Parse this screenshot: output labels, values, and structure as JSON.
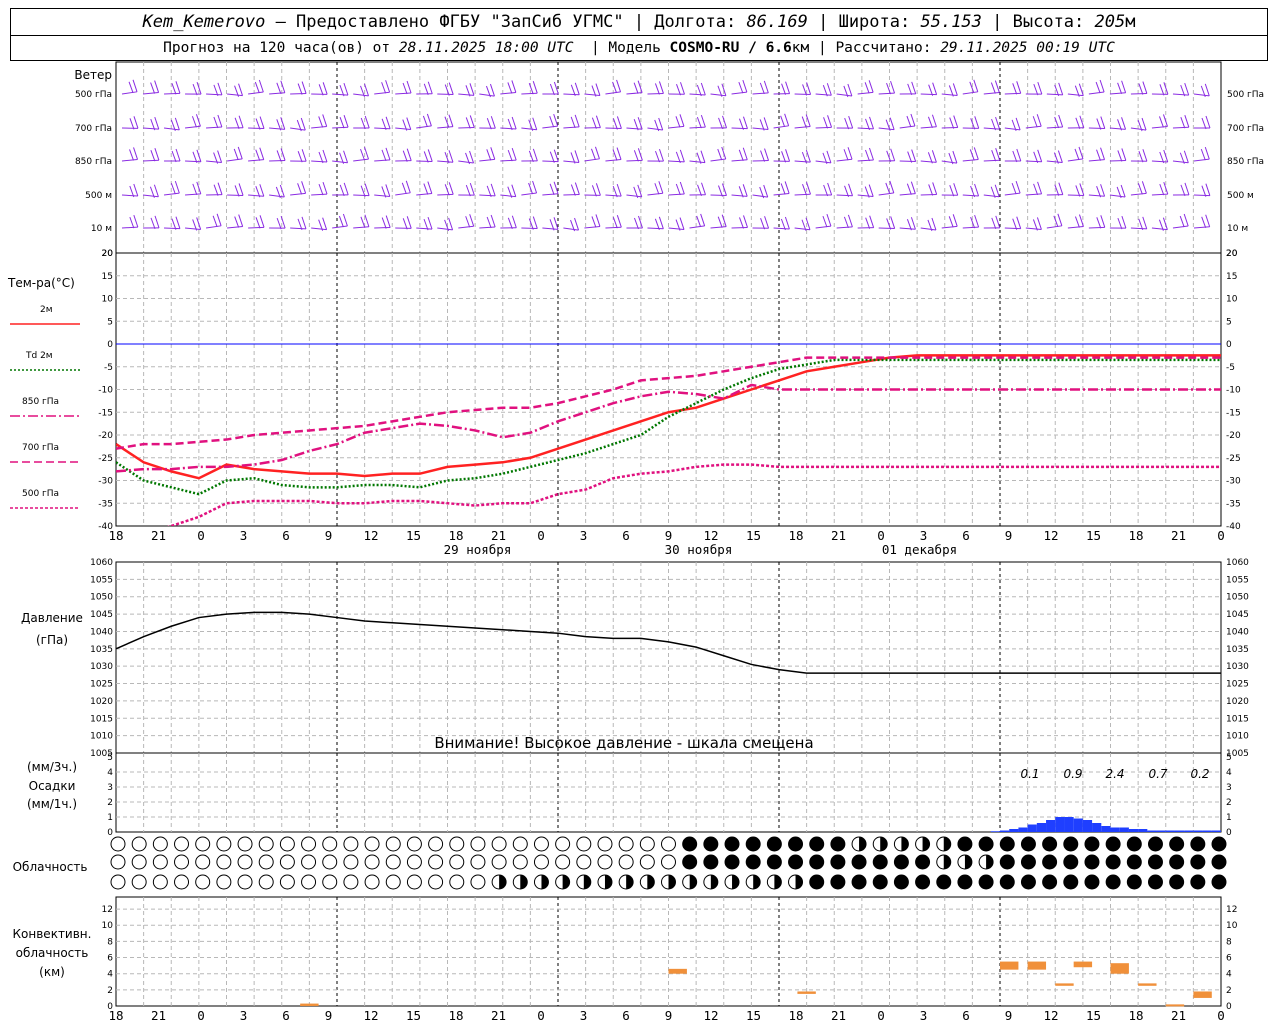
{
  "header": {
    "station": "Kem_Kemerovo",
    "provider": "— Предоставлено ФГБУ \"ЗапСиб УГМС\"",
    "lon_label": "Долгота:",
    "lon": "86.169",
    "lat_label": "Широта:",
    "lat": "55.153",
    "alt_label": "Высота:",
    "alt": "205",
    "alt_unit": "м",
    "fc_label": "Прогноз на 120 часа(ов) от",
    "fc_time": "28.11.2025 18:00 UTC",
    "model_label": "Модель",
    "model": "COSMO-RU / 6.6",
    "model_unit": "км",
    "calc_label": "Рассчитано:",
    "calc_time": "29.11.2025 00:19 UTC"
  },
  "wind_panel": {
    "title": "Ветер",
    "levels": [
      "500 гПа",
      "700 гПа",
      "850 гПа",
      "500 м",
      "10 м"
    ],
    "color": "#8a2be2"
  },
  "temp_panel": {
    "title": "Тем-ра(°C)",
    "legend": [
      {
        "label": "2м",
        "color": "#ff2222",
        "style": "solid"
      },
      {
        "label": "Td 2м",
        "color": "#007700",
        "style": "dotted"
      },
      {
        "label": "850 гПа",
        "color": "#e0117f",
        "style": "dashdot"
      },
      {
        "label": "700 гПа",
        "color": "#e0117f",
        "style": "dashed"
      },
      {
        "label": "500 гПа",
        "color": "#e0117f",
        "style": "dense"
      }
    ],
    "y_ticks": [
      "20",
      "15",
      "10",
      "5",
      "0",
      "-5",
      "-10",
      "-15",
      "-20",
      "-25",
      "-30",
      "-35",
      "-40"
    ],
    "zero_color": "#0000ff"
  },
  "x_axis": {
    "ticks": [
      "18",
      "21",
      "0",
      "3",
      "6",
      "9",
      "12",
      "15",
      "18",
      "21",
      "0",
      "3",
      "6",
      "9",
      "12",
      "15",
      "18",
      "21",
      "0",
      "3",
      "6",
      "9",
      "12",
      "15",
      "18",
      "21",
      "0"
    ],
    "days": [
      "29 ноября",
      "30 ноября",
      "01 декабря"
    ]
  },
  "pressure_panel": {
    "title": "Давление",
    "unit": "(гПа)",
    "y_ticks": [
      "1060",
      "1055",
      "1050",
      "1045",
      "1040",
      "1035",
      "1030",
      "1025",
      "1020",
      "1015",
      "1010",
      "1005"
    ],
    "warning": "Внимание! Высокое давление - шкала смещена"
  },
  "precip_panel": {
    "unit3": "(мм/3ч.)",
    "title": "Осадки",
    "unit1": "(мм/1ч.)",
    "y_ticks": [
      "5",
      "4",
      "3",
      "2",
      "1",
      "0"
    ],
    "totals": [
      "0.1",
      "0.9",
      "2.4",
      "0.7",
      "0.2"
    ],
    "bar_color": "#1f3fff"
  },
  "cloud_panel": {
    "title": "Облачность"
  },
  "conv_panel": {
    "title1": "Конвективн.",
    "title2": "облачность",
    "unit": "(км)",
    "y_ticks": [
      "12",
      "10",
      "8",
      "6",
      "4",
      "2",
      "0"
    ],
    "bar_color": "#f0903a"
  },
  "chart_data": {
    "type": "line",
    "x_hours": [
      0,
      3,
      6,
      9,
      12,
      15,
      18,
      21,
      24,
      27,
      30,
      33,
      36,
      39,
      42,
      45,
      48,
      51,
      54,
      57,
      60,
      63,
      66,
      69,
      72,
      75,
      78,
      81,
      84,
      87,
      90,
      93,
      96,
      99,
      102,
      105,
      108,
      111,
      114,
      117,
      120
    ],
    "temperature": {
      "ylim": [
        -40,
        20
      ],
      "series": [
        {
          "name": "2м",
          "values": [
            -22,
            -26,
            -28,
            -29.5,
            -26.5,
            -27.5,
            -28,
            -28.5,
            -28.5,
            -29,
            -28.5,
            -28.5,
            -27,
            -26.5,
            -26,
            -25,
            -23,
            -21,
            -19,
            -17,
            -15,
            -14,
            -12,
            -10,
            -8,
            -6,
            -5,
            -4,
            -3,
            -2.5,
            -2.5,
            -2.5,
            -2.5,
            -2.5,
            -2.5,
            -2.5,
            -2.5,
            -2.5,
            -2.5,
            -2.5,
            -2.5
          ]
        },
        {
          "name": "Td 2м",
          "values": [
            -26,
            -30,
            -31.5,
            -33,
            -30,
            -29.5,
            -31,
            -31.5,
            -31.5,
            -31,
            -31,
            -31.5,
            -30,
            -29.5,
            -28.5,
            -27,
            -25.5,
            -24,
            -22,
            -20,
            -16,
            -13,
            -10,
            -7.5,
            -5.5,
            -4.5,
            -3.5,
            -3.5,
            -3.5,
            -3.5,
            -3.5,
            -3.5,
            -3.5,
            -3.5,
            -3.5,
            -3.5,
            -3.5,
            -3.5,
            -3.5,
            -3.5,
            -3.5
          ]
        },
        {
          "name": "850 гПа",
          "values": [
            -28,
            -27.5,
            -27.5,
            -27,
            -27,
            -26.5,
            -25.5,
            -23.5,
            -22,
            -19.5,
            -18.5,
            -17.5,
            -18,
            -19,
            -20.5,
            -19.5,
            -17,
            -15,
            -13,
            -11.5,
            -10.5,
            -11,
            -12,
            -9,
            -10,
            -10,
            -10,
            -10,
            -10,
            -10,
            -10,
            -10,
            -10,
            -10,
            -10,
            -10,
            -10,
            -10,
            -10,
            -10,
            -10
          ]
        },
        {
          "name": "700 гПа",
          "values": [
            -23,
            -22,
            -22,
            -21.5,
            -21,
            -20,
            -19.5,
            -19,
            -18.5,
            -18,
            -17,
            -16,
            -15,
            -14.5,
            -14,
            -14,
            -13,
            -11.5,
            -10,
            -8,
            -7.5,
            -7,
            -6,
            -5,
            -4,
            -3,
            -3,
            -3,
            -3,
            -3,
            -3,
            -3,
            -3,
            -3,
            -3,
            -3,
            -3,
            -3,
            -3,
            -3,
            -3
          ]
        },
        {
          "name": "500 гПа",
          "values": [
            -45,
            -42,
            -40,
            -38,
            -35,
            -34.5,
            -34.5,
            -34.5,
            -35,
            -35,
            -34.5,
            -34.5,
            -35,
            -35.5,
            -35,
            -35,
            -33,
            -32,
            -29.5,
            -28.5,
            -28,
            -27,
            -26.5,
            -26.5,
            -27,
            -27,
            -27,
            -27,
            -27,
            -27,
            -27,
            -27,
            -27,
            -27,
            -27,
            -27,
            -27,
            -27,
            -27,
            -27,
            -27
          ]
        }
      ]
    },
    "pressure": {
      "ylim": [
        1005,
        1060
      ],
      "values": [
        1035,
        1038.5,
        1041.5,
        1044,
        1045,
        1045.5,
        1045.5,
        1045,
        1044,
        1043,
        1042.5,
        1042,
        1041.5,
        1041,
        1040.5,
        1040,
        1039.5,
        1038.5,
        1038,
        1038,
        1037,
        1035.5,
        1033,
        1030.5,
        1029,
        1028,
        1028,
        1028,
        1028,
        1028,
        1028,
        1028,
        1028,
        1028,
        1028,
        1028,
        1028,
        1028,
        1028,
        1028,
        1028
      ]
    },
    "precip_1h": {
      "ylim": [
        0,
        5
      ],
      "x_hours": [
        96,
        97,
        98,
        99,
        100,
        101,
        102,
        103,
        104,
        105,
        106,
        107,
        108,
        109,
        110,
        111,
        112,
        113,
        114,
        115,
        116,
        117,
        118,
        119,
        120
      ],
      "values": [
        0.05,
        0.1,
        0.2,
        0.3,
        0.5,
        0.6,
        0.8,
        1.0,
        1.0,
        0.9,
        0.8,
        0.6,
        0.4,
        0.3,
        0.3,
        0.2,
        0.2,
        0.1,
        0.1,
        0.1,
        0.1,
        0.1,
        0.1,
        0.1,
        0.1
      ]
    },
    "convective_cloud_km": {
      "ylim": [
        0,
        13
      ],
      "bars": [
        {
          "x": 20,
          "bottom": 0,
          "top": 0.3
        },
        {
          "x": 60,
          "bottom": 4.0,
          "top": 4.6
        },
        {
          "x": 74,
          "bottom": 1.5,
          "top": 1.8
        },
        {
          "x": 96,
          "bottom": 4.5,
          "top": 5.5
        },
        {
          "x": 99,
          "bottom": 4.5,
          "top": 5.5
        },
        {
          "x": 102,
          "bottom": 2.5,
          "top": 2.8
        },
        {
          "x": 104,
          "bottom": 4.8,
          "top": 5.5
        },
        {
          "x": 108,
          "bottom": 4.0,
          "top": 5.3
        },
        {
          "x": 111,
          "bottom": 2.5,
          "top": 2.8
        },
        {
          "x": 114,
          "bottom": 0,
          "top": 0.2
        },
        {
          "x": 117,
          "bottom": 1.0,
          "top": 1.8
        }
      ]
    }
  }
}
